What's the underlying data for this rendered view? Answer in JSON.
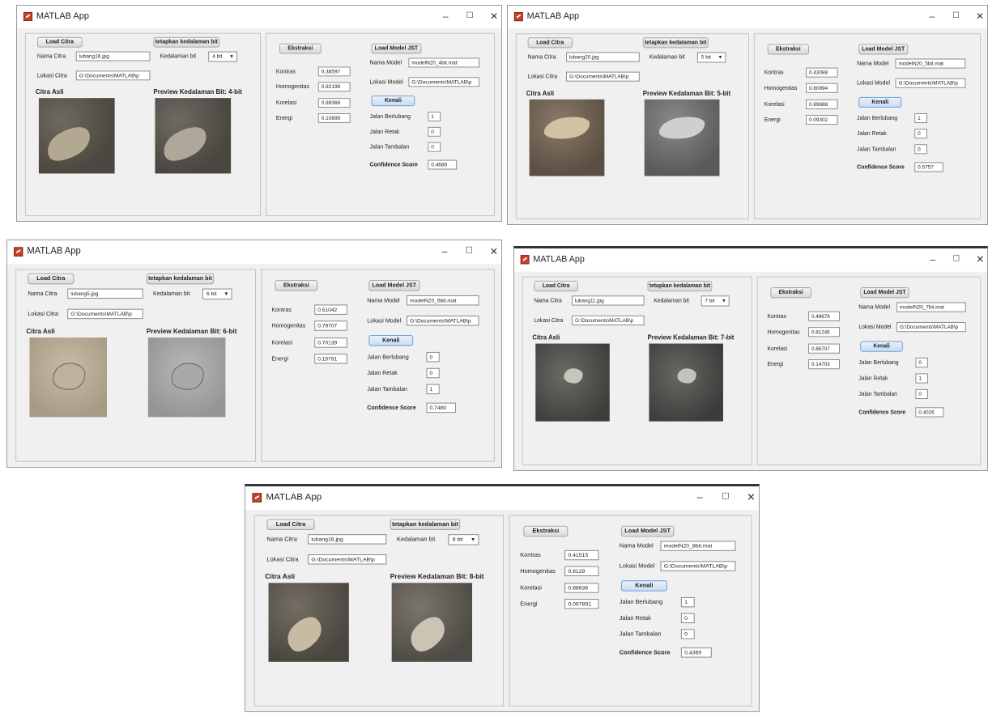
{
  "app": {
    "title": "MATLAB App",
    "min_icon": "minimize-icon",
    "max_icon": "maximize-icon",
    "close_icon": "close-icon",
    "min_glyph": "–",
    "max_glyph": "☐",
    "close_glyph": "✕"
  },
  "labels": {
    "load_citra": "Load Citra",
    "nama_citra": "Nama Citra",
    "lokasi_citra": "Lokasi Citra",
    "tetapkan": "tetapkan kedalaman bit",
    "kedalaman_bit": "Kedalaman bit",
    "citra_asli": "Citra Asli",
    "preview_prefix": "Preview Kedalaman Bit: ",
    "ekstraksi": "Ekstraksi",
    "kontras": "Kontras",
    "homogenitas": "Homogenitas",
    "korelasi": "Korelasi",
    "energi": "Energi",
    "load_model": "Load Model JST",
    "nama_model": "Nama Model",
    "lokasi_model": "Lokasi Model",
    "kenali": "Kenali",
    "jalan_berlubang": "Jalan Berlubang",
    "jalan_retak": "Jalan Retak",
    "jalan_tambalan": "Jalan Tambalan",
    "confidence": "Confidence Score"
  },
  "windows": [
    {
      "nama_citra": "lubang16.jpg",
      "lokasi_citra": "G:\\Documents\\MATLAB\\p",
      "bit": "4 bit",
      "preview": "Preview Kedalaman Bit: 4-bit",
      "kontras": "0.38597",
      "homogenitas": "0.82199",
      "korelasi": "0.89368",
      "energi": "0.10899",
      "nama_model": "modelN20_4bit.mat",
      "lokasi_model": "G:\\Documents\\MATLAB\\p",
      "berlubang": "1",
      "retak": "0",
      "tambalan": "0",
      "confidence": "0.4686"
    },
    {
      "nama_citra": "lubang20.jpg",
      "lokasi_citra": "G:\\Documents\\MATLAB\\p",
      "bit": "5 bit",
      "preview": "Preview Kedalaman Bit: 5-bit",
      "kontras": "0.43088",
      "homogenitas": "0.80994",
      "korelasi": "0.89688",
      "energi": "0.09302",
      "nama_model": "modelN20_5bit.mat",
      "lokasi_model": "G:\\Documents\\MATLAB\\p",
      "berlubang": "1",
      "retak": "0",
      "tambalan": "0",
      "confidence": "0.5757"
    },
    {
      "nama_citra": "lubang5.jpg",
      "lokasi_citra": "G:\\Documents\\MATLAB\\p",
      "bit": "6 bit",
      "preview": "Preview Kedalaman Bit: 6-bit",
      "kontras": "0.51042",
      "homogenitas": "0.79707",
      "korelasi": "0.70139",
      "energi": "0.15791",
      "nama_model": "modelN20_6bit.mat",
      "lokasi_model": "G:\\Documents\\MATLAB\\p",
      "berlubang": "0",
      "retak": "0",
      "tambalan": "1",
      "confidence": "0.7489"
    },
    {
      "nama_citra": "lubang11.jpg",
      "lokasi_citra": "G:\\Documents\\MATLAB\\p",
      "bit": "7 bit",
      "preview": "Preview Kedalaman Bit: 7-bit",
      "kontras": "0.48676",
      "homogenitas": "0.81245",
      "korelasi": "0.86707",
      "energi": "0.14703",
      "nama_model": "modelN20_7bit.mat",
      "lokasi_model": "G:\\Documents\\MATLAB\\p",
      "berlubang": "0",
      "retak": "1",
      "tambalan": "0",
      "confidence": "0.4026"
    },
    {
      "nama_citra": "lubang16.jpg",
      "lokasi_citra": "G:\\Documents\\MATLAB\\p",
      "bit": "8 bit",
      "preview": "Preview Kedalaman Bit: 8-bit",
      "kontras": "0.41515",
      "homogenitas": "0.8129",
      "korelasi": "0.88636",
      "energi": "0.097891",
      "nama_model": "modelN20_8bit.mat",
      "lokasi_model": "G:\\Documents\\MATLAB\\p",
      "berlubang": "1",
      "retak": "0",
      "tambalan": "0",
      "confidence": "0.4369"
    }
  ]
}
